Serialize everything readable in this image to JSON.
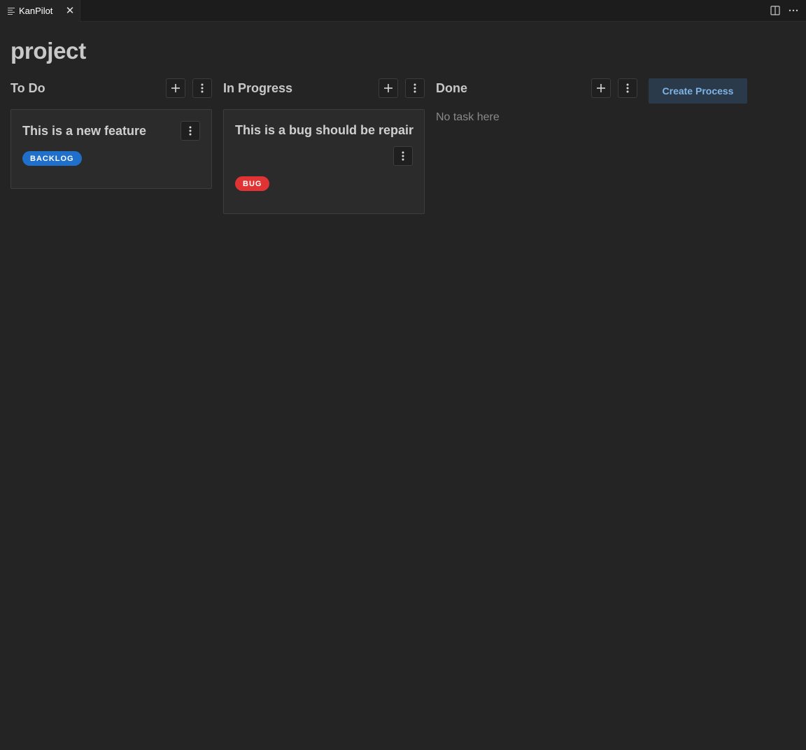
{
  "tab": {
    "label": "KanPilot",
    "close_glyph": "✕",
    "icon": "preview-lines-icon"
  },
  "editor_actions": {
    "split_icon": "split-editor-icon",
    "more_icon": "more-horizontal-icon"
  },
  "page": {
    "title": "project"
  },
  "columns": [
    {
      "title": "To Do",
      "add_icon": "plus-icon",
      "more_icon": "kebab-icon"
    },
    {
      "title": "In Progress",
      "add_icon": "plus-icon",
      "more_icon": "kebab-icon"
    },
    {
      "title": "Done",
      "add_icon": "plus-icon",
      "more_icon": "kebab-icon",
      "empty_text": "No task here"
    }
  ],
  "cards": [
    {
      "title": "This is a new feature",
      "badge": "BACKLOG",
      "badge_color": "#1f6fcb"
    },
    {
      "title": "This is a bug should be repair",
      "badge": "BUG",
      "badge_color": "#e03434"
    }
  ],
  "create_process_label": "Create Process",
  "colors": {
    "background": "#242424",
    "tabbar": "#1c1c1c",
    "card": "#2b2b2b",
    "accent_text": "#7fb4e6"
  }
}
